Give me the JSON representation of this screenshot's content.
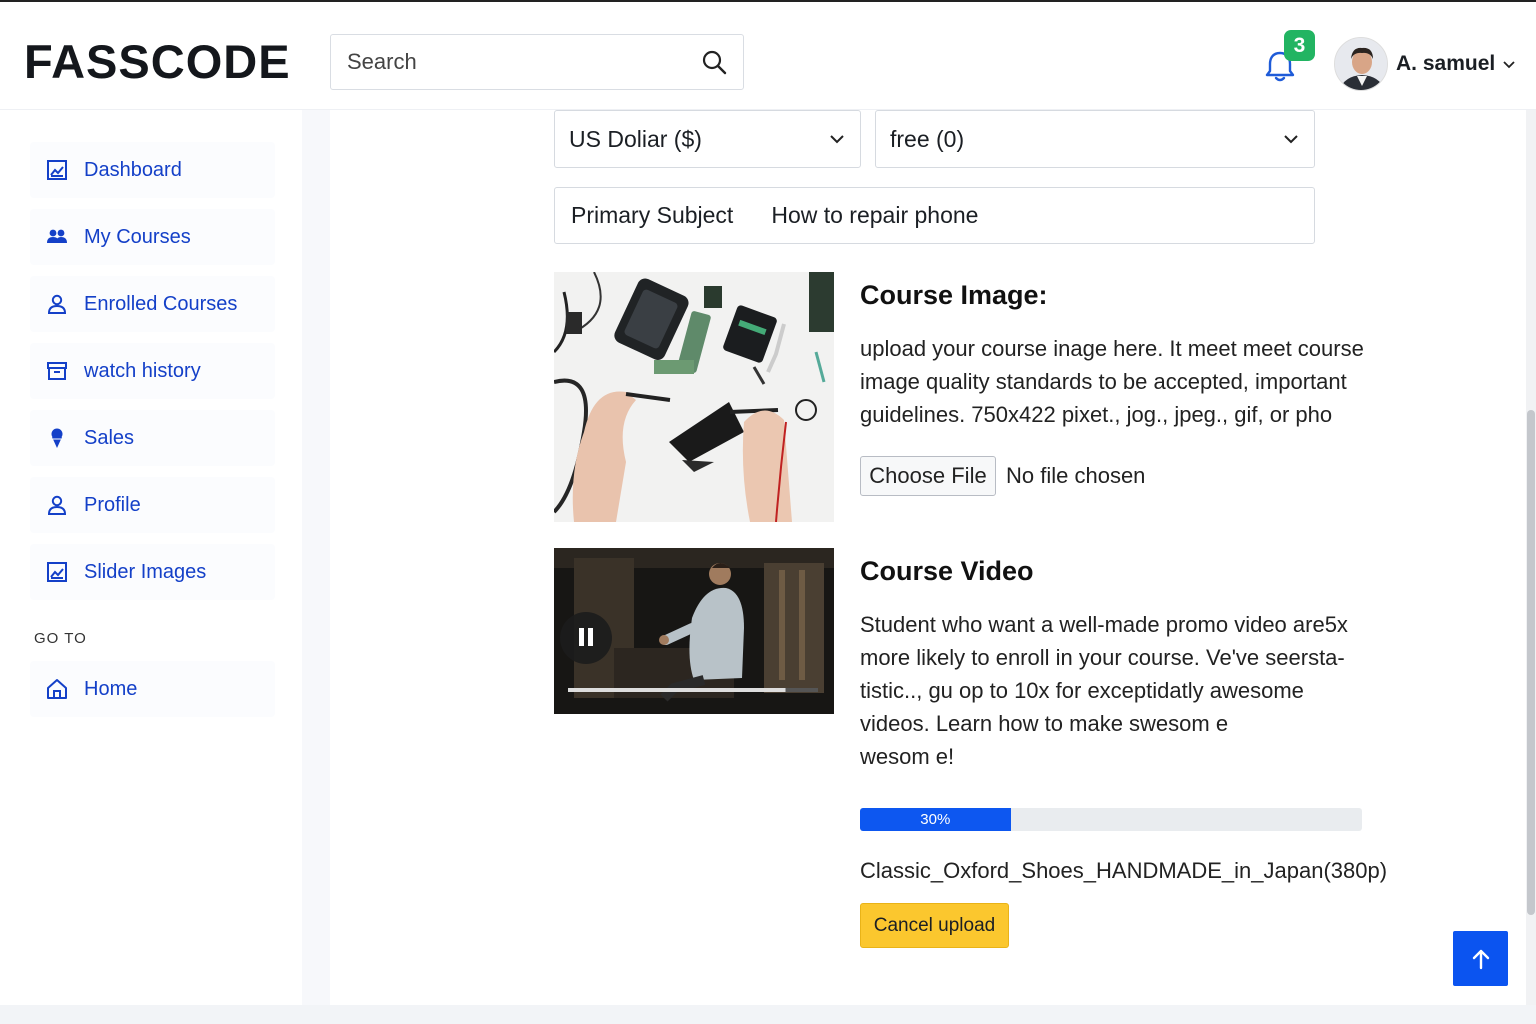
{
  "header": {
    "brand": "FASSCODE",
    "search_placeholder": "Search",
    "notification_count": "3",
    "user_name": "A. samuel"
  },
  "sidebar": {
    "items": [
      {
        "label": "Dashboard",
        "icon": "dashboard-icon"
      },
      {
        "label": "My Courses",
        "icon": "users-icon"
      },
      {
        "label": "Enrolled Courses",
        "icon": "user-icon"
      },
      {
        "label": "watch history",
        "icon": "archive-icon"
      },
      {
        "label": "Sales",
        "icon": "ice-cream-icon"
      },
      {
        "label": "Profile",
        "icon": "user-icon"
      },
      {
        "label": "Slider Images",
        "icon": "image-icon"
      }
    ],
    "goto_label": "GO TO",
    "goto_items": [
      {
        "label": "Home",
        "icon": "home-icon"
      }
    ]
  },
  "form": {
    "currency_select": "US Doliar ($)",
    "price_select": "free (0)",
    "subject_label": "Primary Subject",
    "subject_value": "How to repair phone"
  },
  "course_image": {
    "title": "Course Image:",
    "description": "upload your course inage here. It meet meet course image quality standards to be accepted, important guidelines. 750x422 pixet., jog., jpeg., gif, or pho",
    "choose_file_label": "Choose File",
    "file_status": "No file chosen"
  },
  "course_video": {
    "title": "Course Video",
    "description_lines": [
      "Student who want a well-made promo video are5x",
      "more likely to enroll in your course. Ve've seersta-",
      "tistic.., gu op to 10x for exceptidatly awesome",
      "videos. Learn how to make swesom e",
      "wesom e!"
    ],
    "progress_percent": 30,
    "progress_label": "30%",
    "video_playback_fraction": 0.87,
    "filename": "Classic_Oxford_Shoes_HANDMADE_in_Japan(380p)",
    "cancel_label": "Cancel upload"
  },
  "colors": {
    "accent": "#1440c8",
    "progress": "#0d57f0",
    "badge": "#22b462",
    "cancel": "#fbc72e",
    "to_top": "#0b54f0"
  }
}
